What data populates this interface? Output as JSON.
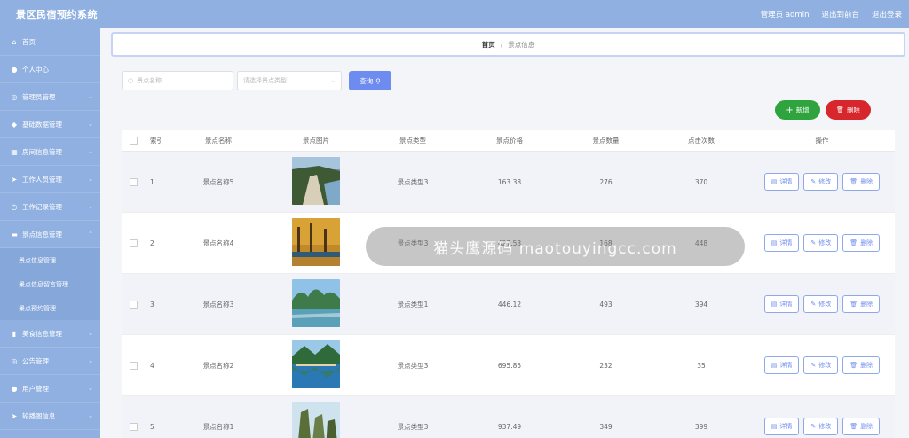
{
  "app": {
    "title": "景区民宿预约系统",
    "user": "管理员 admin",
    "back_to_front": "退出到前台",
    "logout": "退出登录"
  },
  "sidebar": {
    "items": [
      {
        "label": "首页",
        "icon": "home-icon",
        "glyph": "⌂"
      },
      {
        "label": "个人中心",
        "icon": "user-icon",
        "glyph": "●"
      },
      {
        "label": "管理员管理",
        "icon": "admin-icon",
        "glyph": "◎",
        "arrow": "⌄"
      },
      {
        "label": "基础数据管理",
        "icon": "data-icon",
        "glyph": "◆",
        "arrow": "⌄"
      },
      {
        "label": "房间信息管理",
        "icon": "room-icon",
        "glyph": "▦",
        "arrow": "⌄"
      },
      {
        "label": "工作人员管理",
        "icon": "staff-icon",
        "glyph": "➤",
        "arrow": "⌄"
      },
      {
        "label": "工作记录管理",
        "icon": "record-icon",
        "glyph": "◷",
        "arrow": "⌄"
      },
      {
        "label": "景点信息管理",
        "icon": "scenic-icon",
        "glyph": "▬",
        "arrow": "⌃"
      }
    ],
    "sub_items": [
      "景点信息管理",
      "景点信息留言管理",
      "景点预约管理"
    ],
    "items_after": [
      {
        "label": "美食信息管理",
        "icon": "food-icon",
        "glyph": "▮",
        "arrow": "⌄"
      },
      {
        "label": "公告管理",
        "icon": "notice-icon",
        "glyph": "◎",
        "arrow": "⌄"
      },
      {
        "label": "用户管理",
        "icon": "users-icon",
        "glyph": "●",
        "arrow": "⌄"
      },
      {
        "label": "轮播图信息",
        "icon": "carousel-icon",
        "glyph": "➤",
        "arrow": "⌄"
      }
    ]
  },
  "breadcrumb": {
    "home": "首页",
    "sep": "/",
    "current": "景点信息"
  },
  "search": {
    "name_placeholder": "景点名称",
    "type_placeholder": "请选择景点类型",
    "query_label": "查询",
    "search_glyph": "○",
    "chevron_glyph": "⌄",
    "query_glyph": "⚲"
  },
  "actions": {
    "add_label": "新增",
    "add_glyph": "+",
    "delete_label": "删除",
    "delete_glyph": "🗑"
  },
  "table": {
    "headers": [
      "索引",
      "景点名称",
      "景点图片",
      "景点类型",
      "景点价格",
      "景点数量",
      "点击次数",
      "操作"
    ],
    "rows": [
      {
        "index": "1",
        "name": "景点名称5",
        "type": "景点类型3",
        "price": "163.38",
        "count": "276",
        "clicks": "370",
        "img": "aerial"
      },
      {
        "index": "2",
        "name": "景点名称4",
        "type": "景点类型3",
        "price": "427.53",
        "count": "168",
        "clicks": "448",
        "img": "autumn"
      },
      {
        "index": "3",
        "name": "景点名称3",
        "type": "景点类型1",
        "price": "446.12",
        "count": "493",
        "clicks": "394",
        "img": "river"
      },
      {
        "index": "4",
        "name": "景点名称2",
        "type": "景点类型3",
        "price": "695.85",
        "count": "232",
        "clicks": "35",
        "img": "lake"
      },
      {
        "index": "5",
        "name": "景点名称1",
        "type": "景点类型3",
        "price": "937.49",
        "count": "349",
        "clicks": "399",
        "img": "cliff"
      }
    ],
    "ops": {
      "detail": "详情",
      "edit": "修改",
      "delete": "删除",
      "detail_glyph": "▤",
      "edit_glyph": "✎",
      "delete_glyph": "🗑"
    }
  },
  "watermark": "猫头鹰源码 maotouyingcc.com",
  "colors": {
    "sidebar": "#8fb0e0",
    "primary": "#6e8cf0",
    "success": "#2fa33e",
    "danger": "#d8262d"
  }
}
